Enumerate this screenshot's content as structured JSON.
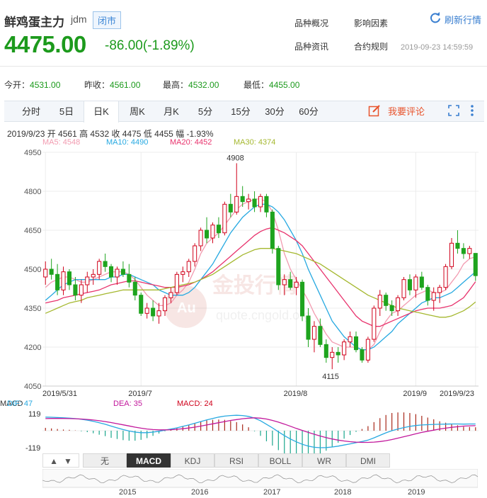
{
  "header": {
    "name": "鲜鸡蛋主力",
    "code": "jdm",
    "status": "闭市",
    "price": "4475.00",
    "change": "-86.00(-1.89%)",
    "links": [
      "品种概况",
      "影响因素",
      "品种资讯",
      "合约规则"
    ],
    "refresh": "刷新行情",
    "time": "2019-09-23 14:59:59"
  },
  "quote": {
    "open_label": "今开：",
    "open": "4531.00",
    "prev_label": "昨收：",
    "prev": "4561.00",
    "high_label": "最高：",
    "high": "4532.00",
    "low_label": "最低：",
    "low": "4455.00"
  },
  "tabs": [
    "分时",
    "5日",
    "日K",
    "周K",
    "月K",
    "5分",
    "15分",
    "30分",
    "60分"
  ],
  "active_tab": "日K",
  "comment": "我要评论",
  "info_line": "2019/9/23  开 4561  高 4532  收 4475  低 4455  幅 -1.93%",
  "ma": [
    {
      "label": "MA5: 4548",
      "color": "#f29bb0"
    },
    {
      "label": "MA10: 4490",
      "color": "#27a9e1"
    },
    {
      "label": "MA20: 4452",
      "color": "#e8336d"
    },
    {
      "label": "MA30: 4374",
      "color": "#a5b82f"
    }
  ],
  "watermark": {
    "brand": "金投行情",
    "url": "quote.cngold.org",
    "logo": "Au"
  },
  "chart_data": [
    {
      "type": "candlestick",
      "y_ticks": [
        "4950",
        "4800",
        "4650",
        "4500",
        "4350",
        "4200",
        "4050"
      ],
      "x_ticks": [
        "2019/5/31",
        "2019/7",
        "2019/8",
        "2019/9",
        "2019/9/23"
      ],
      "ylim": [
        4050,
        4950
      ],
      "annotations": [
        "4908",
        "4115"
      ],
      "candles": [
        [
          4470,
          4530,
          4440,
          4500
        ],
        [
          4500,
          4540,
          4460,
          4480
        ],
        [
          4480,
          4520,
          4400,
          4420
        ],
        [
          4420,
          4510,
          4400,
          4490
        ],
        [
          4490,
          4500,
          4420,
          4440
        ],
        [
          4440,
          4470,
          4380,
          4400
        ],
        [
          4400,
          4460,
          4370,
          4440
        ],
        [
          4440,
          4490,
          4410,
          4470
        ],
        [
          4470,
          4500,
          4440,
          4480
        ],
        [
          4480,
          4540,
          4460,
          4530
        ],
        [
          4530,
          4560,
          4490,
          4510
        ],
        [
          4510,
          4520,
          4450,
          4470
        ],
        [
          4470,
          4510,
          4440,
          4500
        ],
        [
          4500,
          4530,
          4470,
          4480
        ],
        [
          4480,
          4520,
          4430,
          4450
        ],
        [
          4450,
          4470,
          4380,
          4400
        ],
        [
          4400,
          4410,
          4320,
          4330
        ],
        [
          4330,
          4370,
          4310,
          4350
        ],
        [
          4350,
          4380,
          4300,
          4320
        ],
        [
          4320,
          4370,
          4290,
          4340
        ],
        [
          4340,
          4400,
          4320,
          4390
        ],
        [
          4390,
          4430,
          4370,
          4410
        ],
        [
          4410,
          4490,
          4400,
          4480
        ],
        [
          4480,
          4510,
          4450,
          4490
        ],
        [
          4490,
          4540,
          4470,
          4530
        ],
        [
          4530,
          4600,
          4510,
          4590
        ],
        [
          4590,
          4660,
          4570,
          4650
        ],
        [
          4650,
          4700,
          4600,
          4620
        ],
        [
          4620,
          4680,
          4600,
          4670
        ],
        [
          4670,
          4700,
          4620,
          4640
        ],
        [
          4640,
          4760,
          4630,
          4750
        ],
        [
          4750,
          4790,
          4700,
          4720
        ],
        [
          4720,
          4908,
          4710,
          4780
        ],
        [
          4780,
          4820,
          4740,
          4760
        ],
        [
          4760,
          4790,
          4730,
          4770
        ],
        [
          4770,
          4800,
          4720,
          4740
        ],
        [
          4740,
          4790,
          4720,
          4780
        ],
        [
          4780,
          4790,
          4700,
          4720
        ],
        [
          4720,
          4730,
          4560,
          4580
        ],
        [
          4580,
          4590,
          4420,
          4440
        ],
        [
          4440,
          4480,
          4400,
          4460
        ],
        [
          4460,
          4490,
          4420,
          4430
        ],
        [
          4430,
          4470,
          4400,
          4450
        ],
        [
          4450,
          4460,
          4300,
          4320
        ],
        [
          4320,
          4350,
          4200,
          4230
        ],
        [
          4230,
          4300,
          4180,
          4280
        ],
        [
          4280,
          4310,
          4200,
          4210
        ],
        [
          4210,
          4230,
          4140,
          4160
        ],
        [
          4160,
          4200,
          4115,
          4180
        ],
        [
          4180,
          4200,
          4140,
          4170
        ],
        [
          4170,
          4230,
          4150,
          4220
        ],
        [
          4220,
          4260,
          4200,
          4240
        ],
        [
          4240,
          4260,
          4180,
          4190
        ],
        [
          4190,
          4200,
          4140,
          4150
        ],
        [
          4150,
          4240,
          4140,
          4230
        ],
        [
          4230,
          4360,
          4220,
          4350
        ],
        [
          4350,
          4420,
          4320,
          4400
        ],
        [
          4400,
          4410,
          4340,
          4360
        ],
        [
          4360,
          4380,
          4320,
          4340
        ],
        [
          4340,
          4400,
          4320,
          4390
        ],
        [
          4390,
          4470,
          4380,
          4460
        ],
        [
          4460,
          4480,
          4400,
          4420
        ],
        [
          4420,
          4480,
          4390,
          4470
        ],
        [
          4470,
          4490,
          4420,
          4430
        ],
        [
          4430,
          4440,
          4360,
          4380
        ],
        [
          4380,
          4430,
          4340,
          4410
        ],
        [
          4410,
          4440,
          4370,
          4430
        ],
        [
          4430,
          4520,
          4420,
          4510
        ],
        [
          4510,
          4620,
          4500,
          4600
        ],
        [
          4600,
          4650,
          4560,
          4580
        ],
        [
          4580,
          4600,
          4540,
          4560
        ],
        [
          4560,
          4590,
          4540,
          4580
        ],
        [
          4561,
          4532,
          4455,
          4475
        ]
      ],
      "ma_lines": [
        {
          "name": "MA5",
          "color": "#f29bb0",
          "values": [
            4430,
            4450,
            4460,
            4470,
            4470,
            4460,
            4450,
            4450,
            4460,
            4470,
            4480,
            4490,
            4490,
            4490,
            4480,
            4460,
            4430,
            4400,
            4380,
            4360,
            4360,
            4370,
            4400,
            4420,
            4450,
            4500,
            4560,
            4600,
            4620,
            4640,
            4670,
            4700,
            4730,
            4750,
            4760,
            4770,
            4770,
            4760,
            4720,
            4650,
            4560,
            4500,
            4460,
            4420,
            4380,
            4330,
            4290,
            4250,
            4220,
            4210,
            4200,
            4200,
            4200,
            4190,
            4190,
            4210,
            4260,
            4300,
            4330,
            4340,
            4360,
            4380,
            4400,
            4410,
            4420,
            4410,
            4410,
            4420,
            4450,
            4480,
            4520,
            4540,
            4548
          ]
        },
        {
          "name": "MA10",
          "color": "#27a9e1",
          "values": [
            4380,
            4400,
            4420,
            4440,
            4450,
            4460,
            4460,
            4460,
            4460,
            4460,
            4460,
            4470,
            4470,
            4480,
            4480,
            4470,
            4460,
            4450,
            4440,
            4420,
            4410,
            4400,
            4400,
            4400,
            4410,
            4430,
            4460,
            4490,
            4520,
            4560,
            4600,
            4640,
            4670,
            4700,
            4720,
            4740,
            4750,
            4750,
            4740,
            4720,
            4690,
            4650,
            4610,
            4560,
            4500,
            4450,
            4400,
            4350,
            4300,
            4270,
            4240,
            4220,
            4200,
            4190,
            4190,
            4200,
            4220,
            4240,
            4260,
            4290,
            4310,
            4330,
            4350,
            4370,
            4380,
            4390,
            4390,
            4400,
            4410,
            4430,
            4450,
            4470,
            4490
          ]
        },
        {
          "name": "MA20",
          "color": "#e8336d",
          "values": [
            4370,
            4375,
            4380,
            4390,
            4395,
            4400,
            4405,
            4410,
            4415,
            4420,
            4430,
            4440,
            4445,
            4450,
            4455,
            4455,
            4450,
            4445,
            4440,
            4435,
            4430,
            4430,
            4430,
            4435,
            4440,
            4450,
            4460,
            4475,
            4490,
            4510,
            4530,
            4550,
            4570,
            4590,
            4610,
            4630,
            4645,
            4655,
            4660,
            4650,
            4640,
            4625,
            4610,
            4590,
            4560,
            4530,
            4500,
            4470,
            4440,
            4410,
            4380,
            4350,
            4320,
            4300,
            4290,
            4280,
            4280,
            4290,
            4300,
            4310,
            4320,
            4330,
            4340,
            4345,
            4350,
            4350,
            4350,
            4355,
            4360,
            4375,
            4390,
            4420,
            4452
          ]
        },
        {
          "name": "MA30",
          "color": "#a5b82f",
          "values": [
            4330,
            4340,
            4350,
            4360,
            4370,
            4375,
            4380,
            4390,
            4395,
            4400,
            4405,
            4410,
            4415,
            4420,
            4420,
            4420,
            4420,
            4420,
            4420,
            4420,
            4425,
            4430,
            4435,
            4440,
            4445,
            4450,
            4460,
            4470,
            4480,
            4495,
            4510,
            4525,
            4540,
            4555,
            4565,
            4575,
            4580,
            4580,
            4580,
            4575,
            4570,
            4565,
            4560,
            4550,
            4540,
            4530,
            4520,
            4505,
            4490,
            4475,
            4460,
            4445,
            4430,
            4415,
            4400,
            4390,
            4380,
            4370,
            4360,
            4350,
            4345,
            4340,
            4335,
            4330,
            4325,
            4320,
            4315,
            4315,
            4320,
            4330,
            4340,
            4355,
            4374
          ]
        }
      ]
    },
    {
      "type": "macd",
      "labels": [
        "MACD",
        "DIF: 47",
        "DEA: 35",
        "MACD: 24"
      ],
      "y_ticks": [
        "119",
        "-119"
      ],
      "ylim": [
        -119,
        119
      ],
      "dif": [
        95,
        94,
        92,
        90,
        88,
        85,
        80,
        74,
        66,
        56,
        45,
        32,
        20,
        8,
        -2,
        -10,
        -14,
        -14,
        -10,
        -4,
        4,
        12,
        20,
        30,
        40,
        52,
        64,
        76,
        86,
        95,
        102,
        106,
        108,
        106,
        100,
        88,
        70,
        45,
        20,
        -8,
        -34,
        -58,
        -78,
        -95,
        -108,
        -116,
        -119,
        -118,
        -114,
        -108,
        -100,
        -92,
        -84,
        -76,
        -66,
        -50,
        -32,
        -15,
        0,
        12,
        22,
        30,
        36,
        40,
        42,
        44,
        45,
        46,
        47,
        47,
        46,
        47,
        47
      ],
      "dea": [
        85,
        86,
        86,
        86,
        85,
        84,
        82,
        79,
        75,
        70,
        64,
        57,
        49,
        41,
        33,
        25,
        18,
        12,
        8,
        6,
        6,
        7,
        10,
        14,
        19,
        25,
        32,
        40,
        48,
        56,
        64,
        72,
        78,
        84,
        88,
        90,
        88,
        82,
        72,
        60,
        46,
        31,
        16,
        2,
        -12,
        -25,
        -37,
        -48,
        -58,
        -66,
        -72,
        -77,
        -80,
        -82,
        -82,
        -80,
        -76,
        -70,
        -62,
        -52,
        -42,
        -32,
        -22,
        -12,
        -4,
        4,
        12,
        18,
        24,
        28,
        32,
        34,
        35
      ]
    }
  ],
  "bottom_tabs": [
    "无",
    "MACD",
    "KDJ",
    "RSI",
    "BOLL",
    "WR",
    "DMI"
  ],
  "active_bottom_tab": "MACD",
  "arrows": [
    "▲",
    "▼"
  ],
  "timeline_years": [
    "2015",
    "2016",
    "2017",
    "2018",
    "2019"
  ]
}
